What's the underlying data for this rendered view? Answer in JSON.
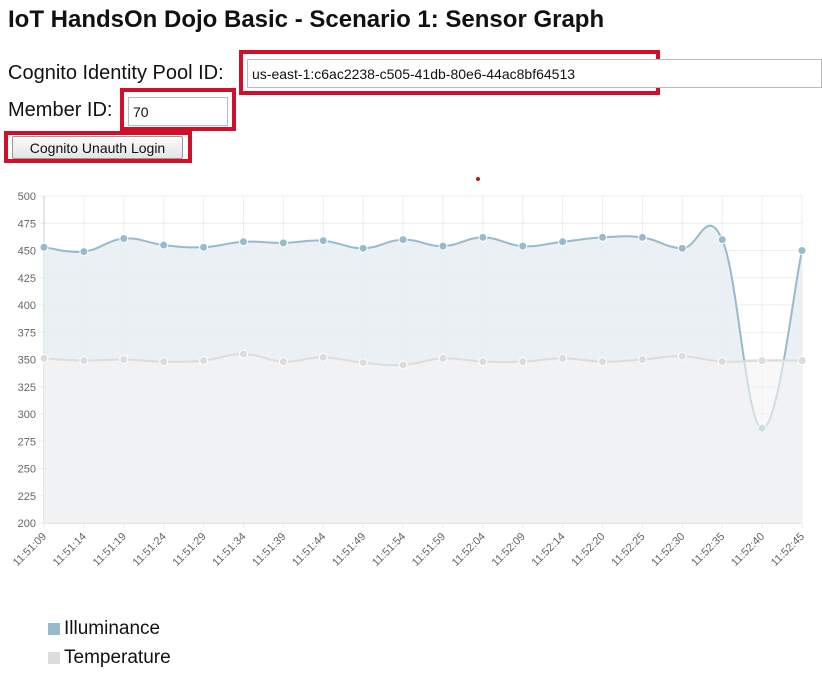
{
  "page": {
    "title": "IoT HandsOn Dojo Basic - Scenario 1: Sensor Graph"
  },
  "form": {
    "pool_label": "Cognito Identity Pool ID:",
    "pool_value": "us-east-1:c6ac2238-c505-41db-80e6-44ac8bf64513",
    "member_label": "Member ID:",
    "member_value": "70",
    "login_button": "Cognito Unauth Login"
  },
  "colors": {
    "highlight": "#d0102a",
    "illuminance_line": "#97bbcd",
    "illuminance_fill": "#e8eef2",
    "temperature_line": "#dcdcdc",
    "temperature_fill": "#f4f4f4"
  },
  "chart_data": {
    "type": "line",
    "title": "",
    "xlabel": "",
    "ylabel": "",
    "ylim": [
      200,
      500
    ],
    "yticks": [
      200,
      225,
      250,
      275,
      300,
      325,
      350,
      375,
      400,
      425,
      450,
      475,
      500
    ],
    "grid": true,
    "legend_position": "bottom-left",
    "categories": [
      "11:51:09",
      "11:51:14",
      "11:51:19",
      "11:51:24",
      "11:51:29",
      "11:51:34",
      "11:51:39",
      "11:51:44",
      "11:51:49",
      "11:51:54",
      "11:51:59",
      "11:52:04",
      "11:52:09",
      "11:52:14",
      "11:52:20",
      "11:52:25",
      "11:52:30",
      "11:52:35",
      "11:52:40",
      "11:52:45"
    ],
    "series": [
      {
        "name": "Illuminance",
        "color": "#97bbcd",
        "fill": "#e8eef2",
        "values": [
          453,
          449,
          461,
          455,
          453,
          458,
          457,
          459,
          452,
          460,
          454,
          462,
          454,
          458,
          462,
          462,
          452,
          460,
          287,
          450
        ]
      },
      {
        "name": "Temperature",
        "color": "#dcdcdc",
        "fill": "#f4f4f4",
        "values": [
          351,
          349,
          350,
          348,
          349,
          355,
          348,
          352,
          347,
          345,
          351,
          348,
          348,
          351,
          348,
          350,
          353,
          348,
          349,
          349
        ]
      }
    ]
  }
}
